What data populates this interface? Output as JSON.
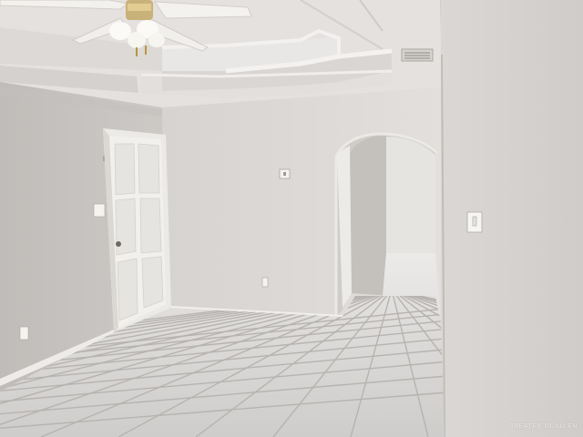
{
  "scene": {
    "subject": "empty-room-interior",
    "colors": {
      "ceiling": "#e4e1df",
      "wall_left": "#c8c4c1",
      "wall_back": "#dcd9d6",
      "wall_right": "#d3d0cd",
      "floor_tile": "#d6d4d2",
      "grout": "#b7b4b1",
      "door": "#f1efec",
      "trim": "#eeece9"
    }
  },
  "watermark": {
    "text": "GREATER MCALLEN"
  }
}
